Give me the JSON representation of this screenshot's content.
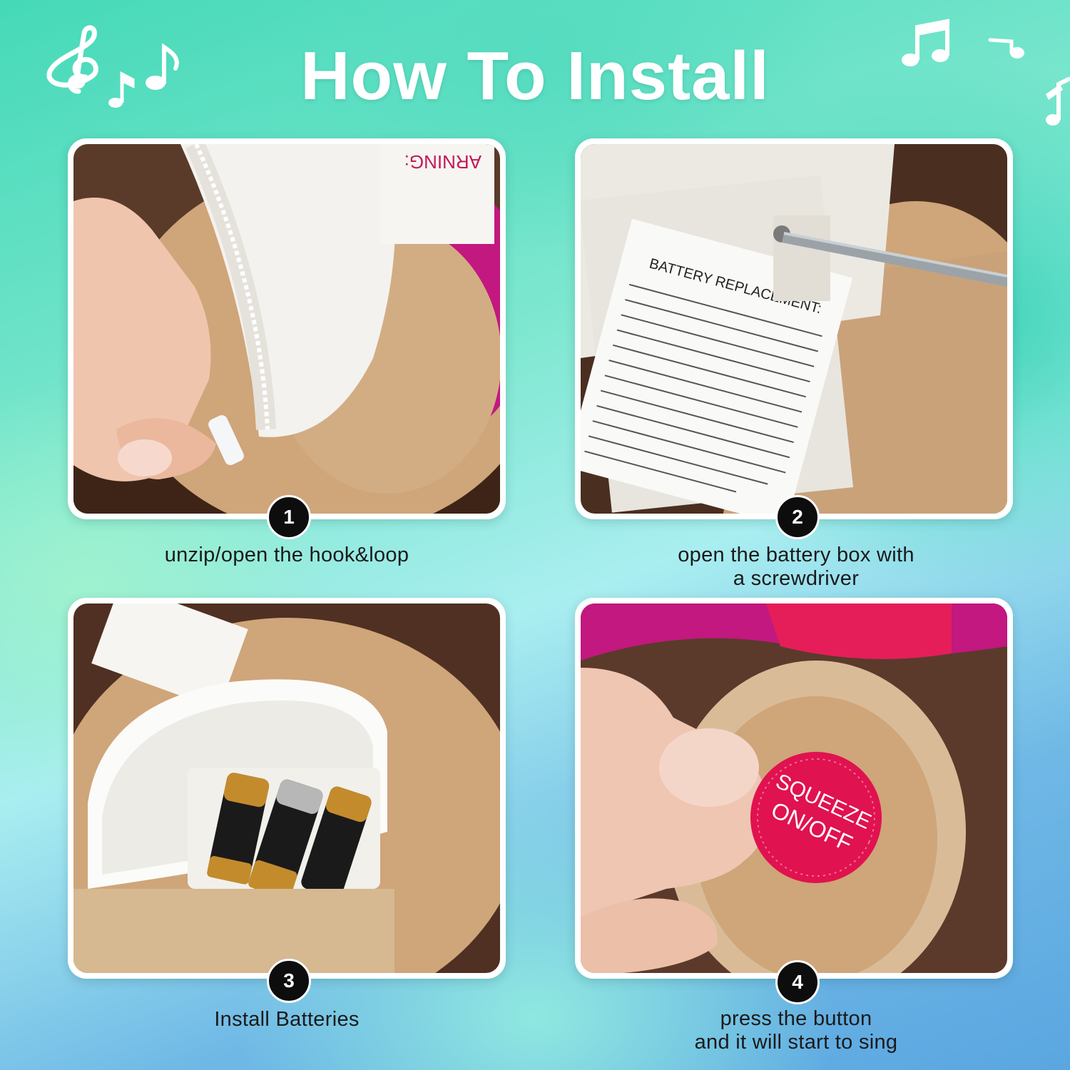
{
  "title": "How To Install",
  "steps": [
    {
      "number": "1",
      "caption": "unzip/open the hook&loop"
    },
    {
      "number": "2",
      "caption_line1": "open the battery box with",
      "caption_line2": "a screwdriver"
    },
    {
      "number": "3",
      "caption": "Install Batteries"
    },
    {
      "number": "4",
      "caption_line1": "press the button",
      "caption_line2": "and it will start to sing"
    }
  ],
  "photo_text": {
    "label_title": "BATTERY REPLACEMENT:",
    "button_line1": "SQUEEZE",
    "button_line2": "ON/OFF",
    "warning_tag": "ARNING:"
  },
  "decor_icons": [
    "treble-clef-icon",
    "music-note-icon",
    "eighth-notes-icon"
  ],
  "colors": {
    "accent": "#ffffff",
    "badge": "#0d0d0d",
    "button_red": "#e0124f",
    "plush": "#cfa57a"
  }
}
